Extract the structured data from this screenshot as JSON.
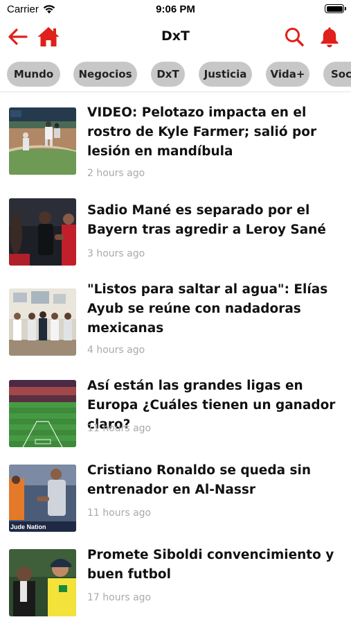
{
  "status": {
    "carrier": "Carrier",
    "time": "9:06 PM"
  },
  "nav": {
    "title": "DxT",
    "accent": "#e0201b"
  },
  "chips": [
    "Mundo",
    "Negocios",
    "DxT",
    "Justicia",
    "Vida+",
    "Soci"
  ],
  "news": [
    {
      "title": "VIDEO: Pelotazo impacta en el rostro de Kyle Farmer; salió por lesión en mandíbula",
      "time": "2 hours ago"
    },
    {
      "title": "Sadio Mané es separado por el Bayern tras agredir a Leroy Sané",
      "time": "3 hours ago"
    },
    {
      "title": "\"Listos para saltar al agua\": Elías Ayub se reúne con nadadoras mexicanas",
      "time": "4 hours ago"
    },
    {
      "title": "Así están las grandes ligas en Europa ¿Cuáles tienen un ganador claro?",
      "time": "11 hours ago"
    },
    {
      "title": "Cristiano Ronaldo se queda sin entrenador en Al-Nassr",
      "time": "11 hours ago",
      "thumb_caption": "Jude Nation"
    },
    {
      "title": "Promete Siboldi convencimiento y buen futbol",
      "time": "17 hours ago"
    }
  ]
}
